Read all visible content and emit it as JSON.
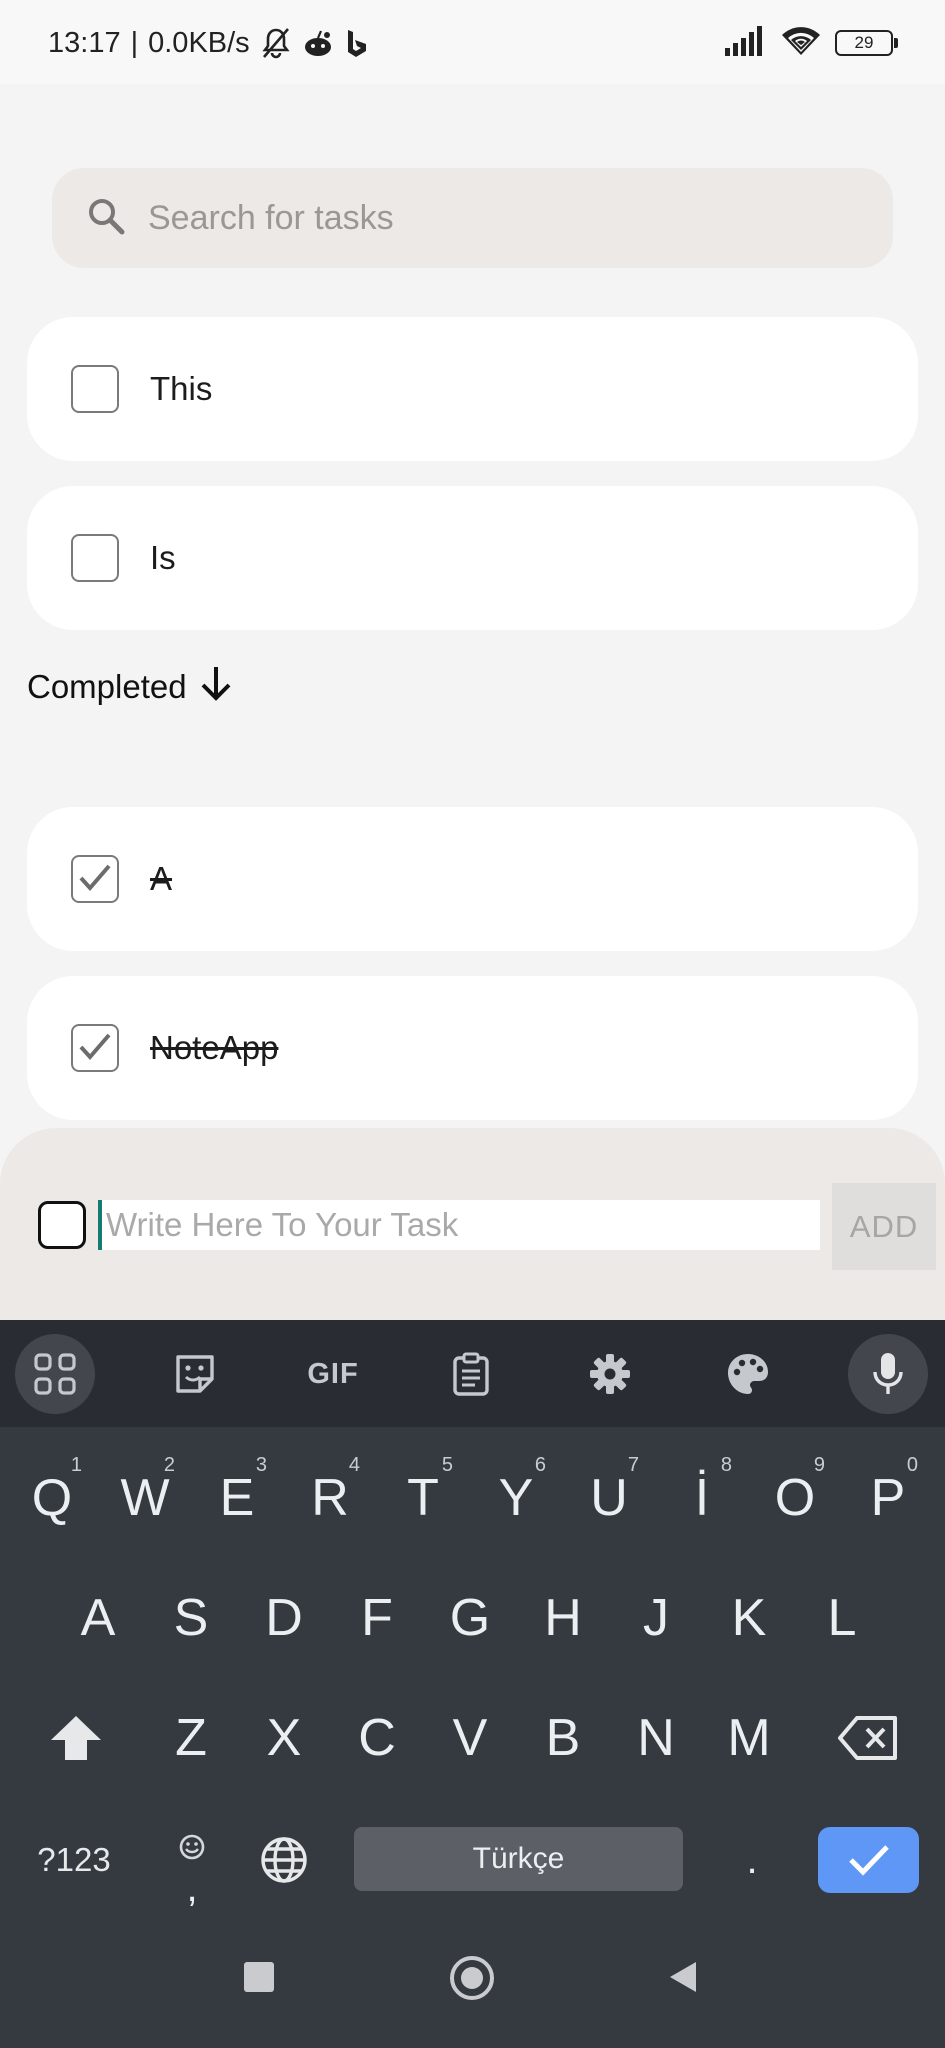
{
  "status_bar": {
    "time": "13:17",
    "speed": "0.0KB/s",
    "battery": "29",
    "icons": [
      "bell-off-icon",
      "reddit-icon",
      "bing-icon",
      "signal-icon",
      "wifi-icon",
      "battery-icon"
    ]
  },
  "search": {
    "placeholder": "Search for tasks"
  },
  "tasks": [
    {
      "label": "This",
      "checked": false
    },
    {
      "label": "Is",
      "checked": false
    }
  ],
  "completed_header": {
    "label": "Completed"
  },
  "completed_tasks": [
    {
      "label": "A",
      "checked": true
    },
    {
      "label": "NoteApp",
      "checked": true
    }
  ],
  "new_task": {
    "placeholder": "Write Here To Your Task",
    "value": "",
    "add_label": "ADD"
  },
  "keyboard": {
    "toolbar": [
      "apps-icon",
      "sticker-icon",
      "GIF",
      "clipboard-icon",
      "settings-icon",
      "palette-icon",
      "microphone-icon"
    ],
    "gif_label": "GIF",
    "row1": [
      {
        "k": "Q",
        "h": "1"
      },
      {
        "k": "W",
        "h": "2"
      },
      {
        "k": "E",
        "h": "3"
      },
      {
        "k": "R",
        "h": "4"
      },
      {
        "k": "T",
        "h": "5"
      },
      {
        "k": "Y",
        "h": "6"
      },
      {
        "k": "U",
        "h": "7"
      },
      {
        "k": "İ",
        "h": "8"
      },
      {
        "k": "O",
        "h": "9"
      },
      {
        "k": "P",
        "h": "0"
      }
    ],
    "row2": [
      "A",
      "S",
      "D",
      "F",
      "G",
      "H",
      "J",
      "K",
      "L"
    ],
    "row3": [
      "Z",
      "X",
      "C",
      "V",
      "B",
      "N",
      "M"
    ],
    "symbols_label": "?123",
    "comma_label": ",",
    "space_label": "Türkçe",
    "period_label": "."
  },
  "colors": {
    "background": "#f4f4f4",
    "search_bg": "#ede9e7",
    "card_bg": "#ffffff",
    "keyboard_bg": "#353a40",
    "enter_key": "#5e97f6",
    "cursor": "#157a72"
  }
}
